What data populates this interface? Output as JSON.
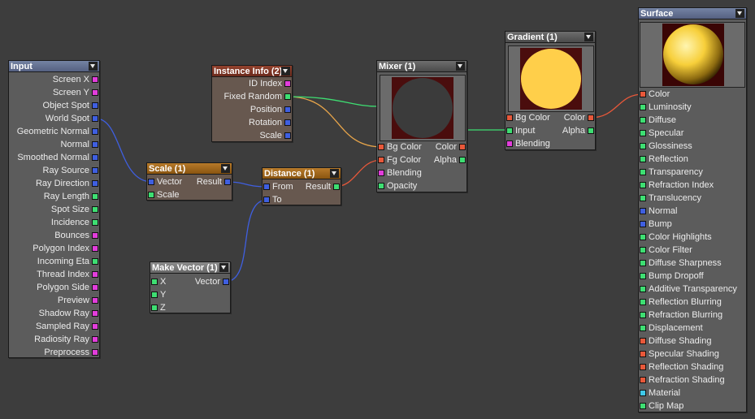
{
  "colors": {
    "magenta": "#e23ddb",
    "blue": "#3f5fe0",
    "green": "#3ede72",
    "red": "#e8583a",
    "cyan": "#3fc8e8"
  },
  "nodes": {
    "input": {
      "title": "Input",
      "outputs": [
        {
          "label": "Screen X",
          "type": "magenta"
        },
        {
          "label": "Screen Y",
          "type": "magenta"
        },
        {
          "label": "Object Spot",
          "type": "blue"
        },
        {
          "label": "World Spot",
          "type": "blue"
        },
        {
          "label": "Geometric Normal",
          "type": "blue"
        },
        {
          "label": "Normal",
          "type": "blue"
        },
        {
          "label": "Smoothed Normal",
          "type": "blue"
        },
        {
          "label": "Ray Source",
          "type": "blue"
        },
        {
          "label": "Ray Direction",
          "type": "blue"
        },
        {
          "label": "Ray Length",
          "type": "green"
        },
        {
          "label": "Spot Size",
          "type": "green"
        },
        {
          "label": "Incidence",
          "type": "green"
        },
        {
          "label": "Bounces",
          "type": "magenta"
        },
        {
          "label": "Polygon Index",
          "type": "magenta"
        },
        {
          "label": "Incoming Eta",
          "type": "green"
        },
        {
          "label": "Thread Index",
          "type": "magenta"
        },
        {
          "label": "Polygon Side",
          "type": "magenta"
        },
        {
          "label": "Preview",
          "type": "magenta"
        },
        {
          "label": "Shadow Ray",
          "type": "magenta"
        },
        {
          "label": "Sampled Ray",
          "type": "magenta"
        },
        {
          "label": "Radiosity Ray",
          "type": "magenta"
        },
        {
          "label": "Preprocess",
          "type": "magenta"
        }
      ]
    },
    "instance_info": {
      "title": "Instance Info (2)",
      "outputs": [
        {
          "label": "ID Index",
          "type": "magenta"
        },
        {
          "label": "Fixed Random",
          "type": "green"
        },
        {
          "label": "Position",
          "type": "blue"
        },
        {
          "label": "Rotation",
          "type": "blue"
        },
        {
          "label": "Scale",
          "type": "blue"
        }
      ]
    },
    "scale": {
      "title": "Scale (1)",
      "inputs": [
        {
          "label": "Vector",
          "type": "blue"
        },
        {
          "label": "Scale",
          "type": "green"
        }
      ],
      "outputs": [
        {
          "label": "Result",
          "type": "blue"
        }
      ]
    },
    "distance": {
      "title": "Distance (1)",
      "inputs": [
        {
          "label": "From",
          "type": "blue"
        },
        {
          "label": "To",
          "type": "blue"
        }
      ],
      "outputs": [
        {
          "label": "Result",
          "type": "green"
        }
      ]
    },
    "make_vector": {
      "title": "Make Vector (1)",
      "inputs": [
        {
          "label": "X",
          "type": "green"
        },
        {
          "label": "Y",
          "type": "green"
        },
        {
          "label": "Z",
          "type": "green"
        }
      ],
      "outputs": [
        {
          "label": "Vector",
          "type": "blue"
        }
      ]
    },
    "mixer": {
      "title": "Mixer (1)",
      "inputs": [
        {
          "label": "Bg Color",
          "type": "red"
        },
        {
          "label": "Fg Color",
          "type": "red"
        },
        {
          "label": "Blending",
          "type": "magenta"
        },
        {
          "label": "Opacity",
          "type": "green"
        }
      ],
      "outputs": [
        {
          "label": "Color",
          "type": "red"
        },
        {
          "label": "Alpha",
          "type": "green"
        }
      ]
    },
    "gradient": {
      "title": "Gradient (1)",
      "inputs": [
        {
          "label": "Bg Color",
          "type": "red"
        },
        {
          "label": "Input",
          "type": "green"
        },
        {
          "label": "Blending",
          "type": "magenta"
        }
      ],
      "outputs": [
        {
          "label": "Color",
          "type": "red"
        },
        {
          "label": "Alpha",
          "type": "green"
        }
      ]
    },
    "surface": {
      "title": "Surface",
      "inputs": [
        {
          "label": "Color",
          "type": "red"
        },
        {
          "label": "Luminosity",
          "type": "green"
        },
        {
          "label": "Diffuse",
          "type": "green"
        },
        {
          "label": "Specular",
          "type": "green"
        },
        {
          "label": "Glossiness",
          "type": "green"
        },
        {
          "label": "Reflection",
          "type": "green"
        },
        {
          "label": "Transparency",
          "type": "green"
        },
        {
          "label": "Refraction Index",
          "type": "green"
        },
        {
          "label": "Translucency",
          "type": "green"
        },
        {
          "label": "Normal",
          "type": "blue"
        },
        {
          "label": "Bump",
          "type": "blue"
        },
        {
          "label": "Color Highlights",
          "type": "green"
        },
        {
          "label": "Color Filter",
          "type": "green"
        },
        {
          "label": "Diffuse Sharpness",
          "type": "green"
        },
        {
          "label": "Bump Dropoff",
          "type": "green"
        },
        {
          "label": "Additive Transparency",
          "type": "green"
        },
        {
          "label": "Reflection Blurring",
          "type": "green"
        },
        {
          "label": "Refraction Blurring",
          "type": "green"
        },
        {
          "label": "Displacement",
          "type": "green"
        },
        {
          "label": "Diffuse Shading",
          "type": "red"
        },
        {
          "label": "Specular Shading",
          "type": "red"
        },
        {
          "label": "Reflection Shading",
          "type": "red"
        },
        {
          "label": "Refraction Shading",
          "type": "red"
        },
        {
          "label": "Material",
          "type": "cyan"
        },
        {
          "label": "Clip Map",
          "type": "green"
        }
      ]
    }
  }
}
